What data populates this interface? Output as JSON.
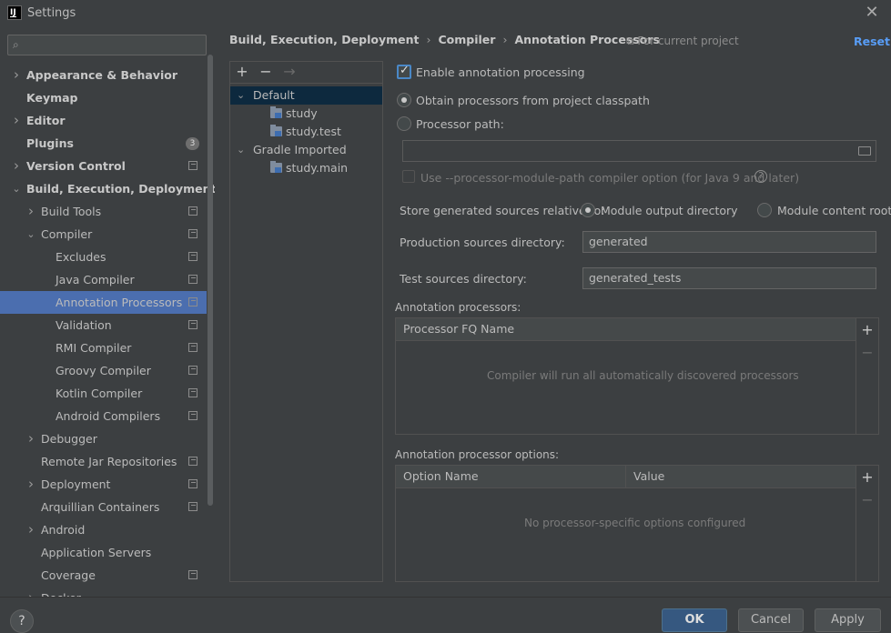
{
  "window": {
    "title": "Settings",
    "logo_text": "IJ"
  },
  "search": {
    "placeholder": ""
  },
  "sidebar": {
    "items": [
      {
        "label": "Appearance & Behavior",
        "bold": true,
        "chevron": "right",
        "level": 0
      },
      {
        "label": "Keymap",
        "bold": true,
        "chevron": "",
        "level": 0
      },
      {
        "label": "Editor",
        "bold": true,
        "chevron": "right",
        "level": 0
      },
      {
        "label": "Plugins",
        "bold": true,
        "chevron": "",
        "level": 0,
        "badge": "3"
      },
      {
        "label": "Version Control",
        "bold": true,
        "chevron": "right",
        "level": 0,
        "project": true
      },
      {
        "label": "Build, Execution, Deployment",
        "bold": true,
        "chevron": "down",
        "level": 0
      },
      {
        "label": "Build Tools",
        "bold": false,
        "chevron": "right",
        "level": 1,
        "project": true
      },
      {
        "label": "Compiler",
        "bold": false,
        "chevron": "down",
        "level": 1,
        "project": true
      },
      {
        "label": "Excludes",
        "bold": false,
        "chevron": "",
        "level": 2,
        "project": true
      },
      {
        "label": "Java Compiler",
        "bold": false,
        "chevron": "",
        "level": 2,
        "project": true
      },
      {
        "label": "Annotation Processors",
        "bold": false,
        "chevron": "",
        "level": 2,
        "project": true,
        "selected": true
      },
      {
        "label": "Validation",
        "bold": false,
        "chevron": "",
        "level": 2,
        "project": true
      },
      {
        "label": "RMI Compiler",
        "bold": false,
        "chevron": "",
        "level": 2,
        "project": true
      },
      {
        "label": "Groovy Compiler",
        "bold": false,
        "chevron": "",
        "level": 2,
        "project": true
      },
      {
        "label": "Kotlin Compiler",
        "bold": false,
        "chevron": "",
        "level": 2,
        "project": true
      },
      {
        "label": "Android Compilers",
        "bold": false,
        "chevron": "",
        "level": 2,
        "project": true
      },
      {
        "label": "Debugger",
        "bold": false,
        "chevron": "right",
        "level": 1
      },
      {
        "label": "Remote Jar Repositories",
        "bold": false,
        "chevron": "",
        "level": 1,
        "project": true
      },
      {
        "label": "Deployment",
        "bold": false,
        "chevron": "right",
        "level": 1,
        "project": true
      },
      {
        "label": "Arquillian Containers",
        "bold": false,
        "chevron": "",
        "level": 1,
        "project": true
      },
      {
        "label": "Android",
        "bold": false,
        "chevron": "right",
        "level": 1
      },
      {
        "label": "Application Servers",
        "bold": false,
        "chevron": "",
        "level": 1
      },
      {
        "label": "Coverage",
        "bold": false,
        "chevron": "",
        "level": 1,
        "project": true
      },
      {
        "label": "Docker",
        "bold": false,
        "chevron": "right",
        "level": 1
      }
    ]
  },
  "header": {
    "breadcrumb": [
      "Build, Execution, Deployment",
      "Compiler",
      "Annotation Processors"
    ],
    "scope": "For current project",
    "reset": "Reset"
  },
  "profiles": {
    "toolbar": {
      "add": "+",
      "remove": "−",
      "move": "→"
    },
    "items": [
      {
        "label": "Default",
        "chevron": "down",
        "level": 0,
        "selected": true
      },
      {
        "label": "study",
        "folder": true,
        "level": 1
      },
      {
        "label": "study.test",
        "folder": true,
        "level": 1
      },
      {
        "label": "Gradle Imported",
        "chevron": "down",
        "level": 0
      },
      {
        "label": "study.main",
        "folder": true,
        "level": 1
      }
    ]
  },
  "settings": {
    "enable_processing": {
      "label": "Enable annotation processing",
      "checked": true
    },
    "obtain_classpath": {
      "label": "Obtain processors from project classpath",
      "checked": true
    },
    "processor_path": {
      "label": "Processor path:",
      "checked": false,
      "value": ""
    },
    "module_path_option": {
      "label": "Use --processor-module-path compiler option (for Java 9 and later)",
      "checked": false
    },
    "store_relative": {
      "label": "Store generated sources relative to:",
      "option_output": "Module output directory",
      "option_content": "Module content root",
      "selected": "Module output directory"
    },
    "production_dir": {
      "label": "Production sources directory:",
      "value": "generated"
    },
    "test_dir": {
      "label": "Test sources directory:",
      "value": "generated_tests"
    },
    "processors_table": {
      "label": "Annotation processors:",
      "columns": [
        "Processor FQ Name"
      ],
      "empty_text": "Compiler will run all automatically discovered processors"
    },
    "options_table": {
      "label": "Annotation processor options:",
      "columns": [
        "Option Name",
        "Value"
      ],
      "empty_text": "No processor-specific options configured"
    }
  },
  "footer": {
    "help": "?",
    "ok": "OK",
    "cancel": "Cancel",
    "apply": "Apply"
  },
  "colors": {
    "accent": "#4b6eaf",
    "link": "#589df6",
    "background": "#3c3f41",
    "default_button": "#365880"
  }
}
